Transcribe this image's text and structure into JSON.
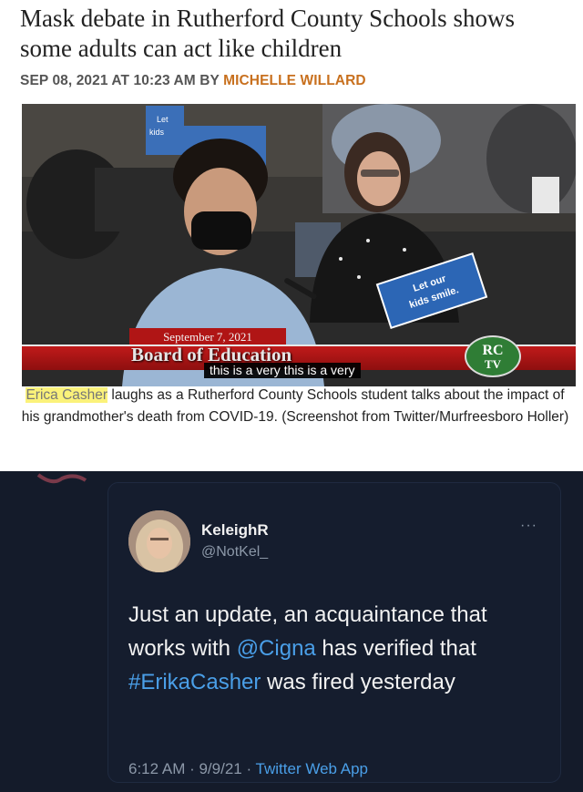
{
  "article": {
    "headline": "Mask debate in Rutherford County Schools shows some adults can act like children",
    "byline_prefix": "SEP 08, 2021 AT 10:23 AM BY ",
    "author": "MICHELLE WILLARD",
    "photo": {
      "sign_back": "Let kids",
      "sign_front": "Let our kids smile.",
      "lower_third_date": "September 7, 2021",
      "lower_third_title": "Board of Education",
      "closed_caption": "this is a very this is a very",
      "logo_top": "RC",
      "logo_bottom": "TV"
    },
    "caption_highlight": "Erica Casher",
    "caption_rest": " laughs as a Rutherford County Schools student talks about the impact of his grandmother's death from COVID-19. (Screenshot from Twitter/Murfreesboro Holler)"
  },
  "tweet": {
    "display_name": "KeleighR",
    "handle": "@NotKel_",
    "more": "···",
    "text_1": "Just an update, an acquaintance that works with ",
    "mention": "@Cigna",
    "text_2": " has verified that ",
    "hashtag": "#ErikaCasher",
    "text_3": " was fired yesterday",
    "timestamp": "6:12 AM · 9/9/21 · ",
    "source": "Twitter Web App"
  },
  "colors": {
    "author": "#c8701e",
    "highlight": "#fbf27a",
    "tweet_bg": "#141b2a",
    "link": "#4a9fe8"
  }
}
